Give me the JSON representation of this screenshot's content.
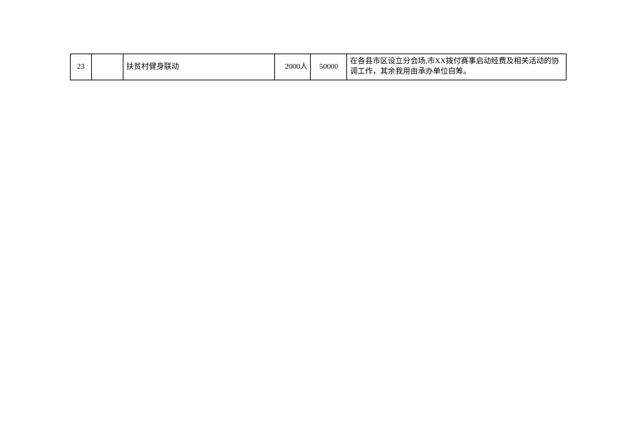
{
  "table": {
    "rows": [
      {
        "index": "23",
        "empty1": "",
        "name": "扶贫村健身联动",
        "count": "2000人",
        "amount": "50000",
        "desc": "在各县市区设立分会场,市XX拨付赛事启动经费及相关活动的协调工作，其余我用由承办单位自筹。"
      }
    ]
  }
}
